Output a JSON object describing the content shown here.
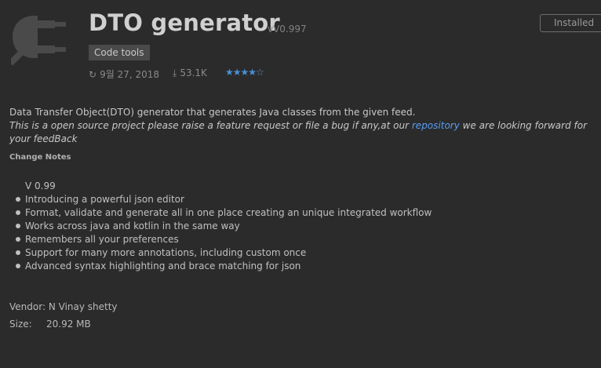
{
  "plugin": {
    "name": "DTO generator",
    "version": "vV0.997",
    "category": "Code tools",
    "date": "9월 27, 2018",
    "downloads": "53.1K",
    "rating": 4.5,
    "rating_stars": "★★★★",
    "rating_half": "☆",
    "install_label": "Installed"
  },
  "description": {
    "line1": "Data Transfer Object(DTO) generator that generates Java classes from the given feed.",
    "line2_pre": "This is a open source project please raise a feature request or file a bug if any,at our ",
    "link": "repository",
    "line2_post": " we are looking forward for your feedBack"
  },
  "change_notes": {
    "heading": "Change Notes",
    "version": "V 0.99",
    "items": [
      "Introducing a powerful json editor",
      "Format, validate and generate all in one place creating an unique integrated workflow",
      "Works across java and kotlin in the same way",
      "Remembers all your preferences",
      "Support for many more annotations, including custom once",
      "Advanced syntax highlighting and brace matching for json"
    ]
  },
  "vendor": {
    "label": "Vendor:",
    "value": "N Vinay shetty"
  },
  "size": {
    "label": "Size:",
    "value": "20.92 MB"
  },
  "icons": {
    "plugin": "plug-icon",
    "date": "refresh-icon",
    "downloads": "download-icon"
  },
  "colors": {
    "background": "#2b2b2b",
    "link": "#589df6",
    "stars": "#4a8fd6"
  }
}
